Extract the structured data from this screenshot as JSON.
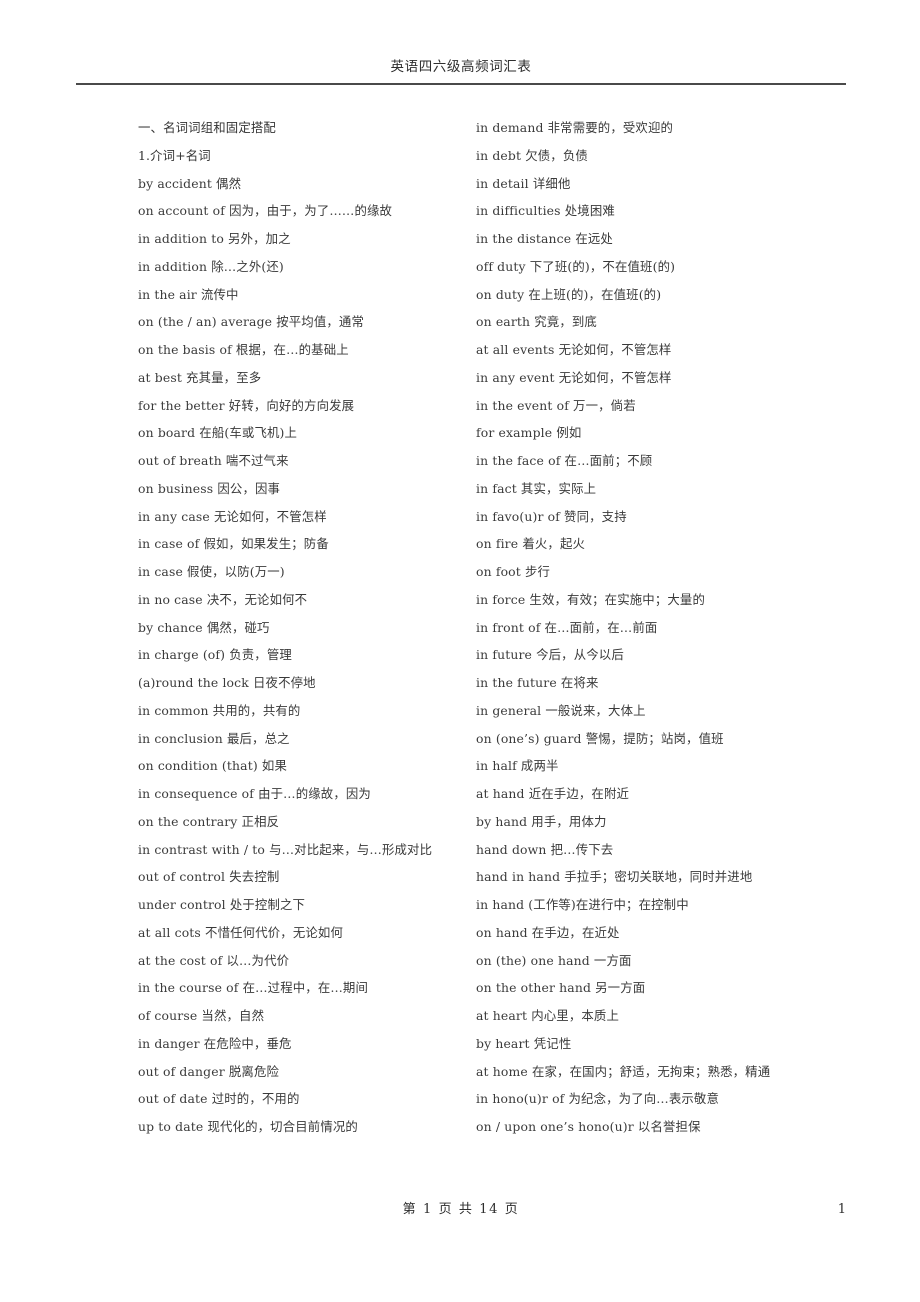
{
  "header": {
    "title": "英语四六级高频词汇表"
  },
  "footer": {
    "page_of_total": "第 1 页 共 14 页",
    "page_number": "1"
  },
  "columns": {
    "left": [
      "一、名词词组和固定搭配",
      "1.介词+名词",
      "by accident 偶然",
      "on account of 因为，由于，为了……的缘故",
      "in addition to 另外，加之",
      "in addition 除…之外(还)",
      "in the air 流传中",
      "on (the / an) average 按平均值，通常",
      "on the basis of 根据，在…的基础上",
      "at best 充其量，至多",
      "for the better 好转，向好的方向发展",
      "on board 在船(车或飞机)上",
      "out of breath 喘不过气来",
      "on business 因公，因事",
      "in any case 无论如何，不管怎样",
      "in case of 假如，如果发生；防备",
      "in case 假使，以防(万一)",
      "in no case 决不，无论如何不",
      "by chance 偶然，碰巧",
      "in charge (of) 负责，管理",
      "(a)round the lock 日夜不停地",
      "in common 共用的，共有的",
      "in conclusion 最后，总之",
      "on condition (that) 如果",
      "in consequence of 由于…的缘故，因为",
      "on the contrary 正相反",
      "in contrast with / to 与…对比起来，与…形成对比",
      "out of control 失去控制",
      "under control 处于控制之下",
      "at all cots 不惜任何代价，无论如何",
      "at the cost of 以…为代价",
      "in the course of 在…过程中，在…期间",
      "of course 当然，自然",
      "in danger 在危险中，垂危",
      "out of danger 脱离危险",
      "out of date 过时的，不用的",
      "up to date 现代化的，切合目前情况的"
    ],
    "right": [
      "in demand 非常需要的，受欢迎的",
      "in debt 欠债，负债",
      "in detail 详细他",
      "in difficulties 处境困难",
      "in the distance 在远处",
      "off duty 下了班(的)，不在值班(的)",
      "on duty 在上班(的)，在值班(的)",
      "on earth 究竟，到底",
      "at all events 无论如何，不管怎样",
      "in any event 无论如何，不管怎样",
      "in the event of 万一，倘若",
      "for example 例如",
      "in the face of 在…面前；不顾",
      "in fact 其实，实际上",
      "in favo(u)r of 赞同，支持",
      "on fire 着火，起火",
      "on foot 步行",
      "in force 生效，有效；在实施中；大量的",
      "in front of 在…面前，在…前面",
      "in future 今后，从今以后",
      "in the future 在将来",
      "in general 一般说来，大体上",
      "on (one’s) guard 警惕，提防；站岗，值班",
      "in half 成两半",
      "at hand 近在手边，在附近",
      "by hand 用手，用体力",
      "hand down 把…传下去",
      "hand in hand 手拉手；密切关联地，同时并进地",
      "in hand (工作等)在进行中；在控制中",
      "on hand 在手边，在近处",
      "on (the) one hand 一方面",
      "on the other hand 另一方面",
      "at heart 内心里，本质上",
      "by heart 凭记性",
      "at home 在家，在国内；舒适，无拘束；熟悉，精通",
      "in hono(u)r of 为纪念，为了向…表示敬意",
      "on / upon one’s hono(u)r 以名誉担保"
    ]
  }
}
